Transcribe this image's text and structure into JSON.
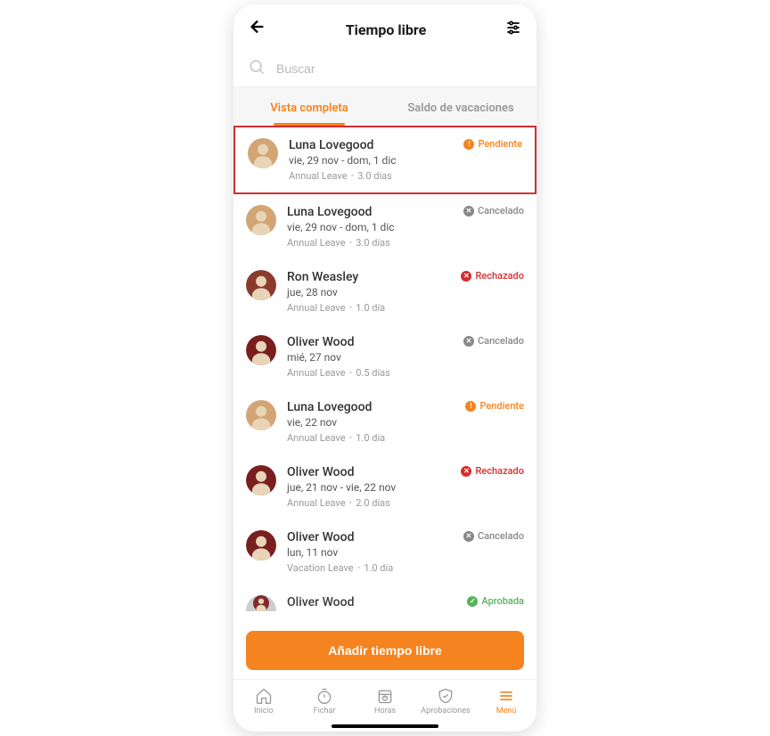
{
  "header": {
    "title": "Tiempo libre"
  },
  "search": {
    "placeholder": "Buscar"
  },
  "tabs": {
    "complete": "Vista completa",
    "balance": "Saldo de vacaciones"
  },
  "requests": [
    {
      "name": "Luna Lovegood",
      "date": "vie, 29 nov - dom, 1 dic",
      "leave_type": "Annual Leave",
      "duration": "3.0 días",
      "status": "Pendiente",
      "status_class": "pendiente",
      "status_glyph": "!",
      "avatar_color": "#d4a574",
      "highlighted": true
    },
    {
      "name": "Luna Lovegood",
      "date": "vie, 29 nov - dom, 1 dic",
      "leave_type": "Annual Leave",
      "duration": "3.0 días",
      "status": "Cancelado",
      "status_class": "cancelado",
      "status_glyph": "✕",
      "avatar_color": "#d4a574"
    },
    {
      "name": "Ron Weasley",
      "date": "jue, 28 nov",
      "leave_type": "Annual Leave",
      "duration": "1.0 día",
      "status": "Rechazado",
      "status_class": "rechazado",
      "status_glyph": "✕",
      "avatar_color": "#8b3a2e"
    },
    {
      "name": "Oliver Wood",
      "date": "mié, 27 nov",
      "leave_type": "Annual Leave",
      "duration": "0.5 días",
      "status": "Cancelado",
      "status_class": "cancelado",
      "status_glyph": "✕",
      "avatar_color": "#7a1f1f"
    },
    {
      "name": "Luna Lovegood",
      "date": "vie, 22 nov",
      "leave_type": "Annual Leave",
      "duration": "1.0 día",
      "status": "Pendiente",
      "status_class": "pendiente",
      "status_glyph": "!",
      "avatar_color": "#d4a574"
    },
    {
      "name": "Oliver Wood",
      "date": "jue, 21 nov - vie, 22 nov",
      "leave_type": "Annual Leave",
      "duration": "2.0 días",
      "status": "Rechazado",
      "status_class": "rechazado",
      "status_glyph": "✕",
      "avatar_color": "#7a1f1f"
    },
    {
      "name": "Oliver Wood",
      "date": "lun, 11 nov",
      "leave_type": "Vacation Leave",
      "duration": "1.0 día",
      "status": "Cancelado",
      "status_class": "cancelado",
      "status_glyph": "✕",
      "avatar_color": "#7a1f1f"
    },
    {
      "name": "Oliver Wood",
      "date": "",
      "leave_type": "",
      "duration": "",
      "status": "Aprobada",
      "status_class": "aprobada",
      "status_glyph": "✓",
      "avatar_color": "#7a1f1f",
      "cut": true
    }
  ],
  "add_button": "Añadir tiempo libre",
  "nav": {
    "home": "Inicio",
    "clock": "Fichar",
    "hours": "Horas",
    "approvals": "Aprobaciones",
    "menu": "Menú"
  }
}
